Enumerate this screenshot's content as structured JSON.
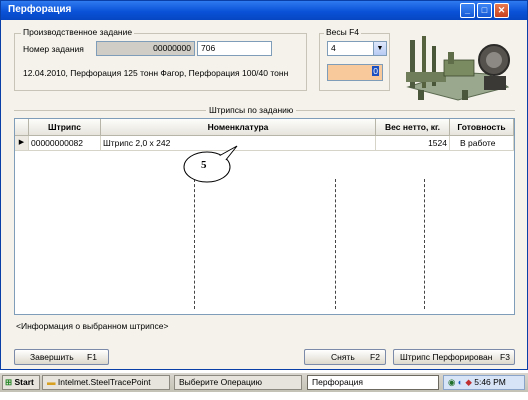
{
  "window": {
    "title": "Перфорация",
    "controls": [
      "_",
      "□",
      "✕"
    ]
  },
  "task_group": {
    "legend": "Производственное задание",
    "task_number_label": "Номер задания",
    "task_number_prefix": "00000000",
    "task_number_value": "706",
    "description": "12.04.2010, Перфорация 125 тонн Фагор, Перфорация 100/40 тонн"
  },
  "scales_group": {
    "legend": "Весы  F4",
    "selected": "4",
    "weight_value": "0"
  },
  "strips_section": {
    "title": "Штрипсы по заданию"
  },
  "grid": {
    "columns": [
      "Штрипс",
      "Номенклатура",
      "Вес нетто, кг.",
      "Готовность"
    ],
    "rows": [
      {
        "strip": "00000000082",
        "nomenclature": "Штрипс 2,0 х 242",
        "weight": "1524",
        "status": "В работе"
      }
    ]
  },
  "callout": {
    "label": "5"
  },
  "info_text": "<Информация о выбранном штрипсе>",
  "buttons": {
    "finish": "Завершить",
    "finish_key": "F1",
    "remove": "Снять",
    "remove_key": "F2",
    "perforated": "Штрипс Перфорирован",
    "perforated_key": "F3"
  },
  "taskbar": {
    "start": "Start",
    "tasks": [
      "Intelmet.SteelTracePoint",
      "Выберите Операцию",
      "Перфорация"
    ],
    "clock": "5:46 PM"
  }
}
